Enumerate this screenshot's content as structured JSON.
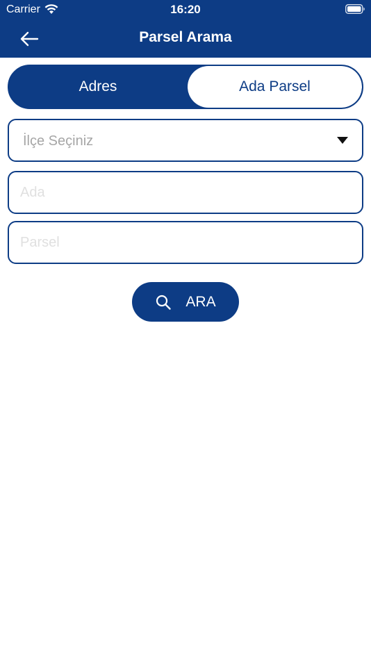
{
  "status_bar": {
    "carrier": "Carrier",
    "time": "16:20",
    "icons": [
      "wifi-icon",
      "battery-icon"
    ]
  },
  "nav": {
    "back_icon": "arrow-left-icon",
    "title": "Parsel Arama"
  },
  "segment": {
    "options": [
      {
        "label": "Adres",
        "selected": true
      },
      {
        "label": "Ada Parsel",
        "selected": false
      }
    ]
  },
  "form": {
    "district_select": {
      "value": "İlçe Seçiniz",
      "icon": "caret-down-icon"
    },
    "ada_input": {
      "value": "",
      "placeholder": "Ada"
    },
    "parsel_input": {
      "value": "",
      "placeholder": "Parsel"
    }
  },
  "search_button": {
    "icon": "search-icon",
    "label": "ARA"
  },
  "colors": {
    "primary": "#0d3c85",
    "background": "#ffffff",
    "placeholder": "#a6a6a6"
  }
}
